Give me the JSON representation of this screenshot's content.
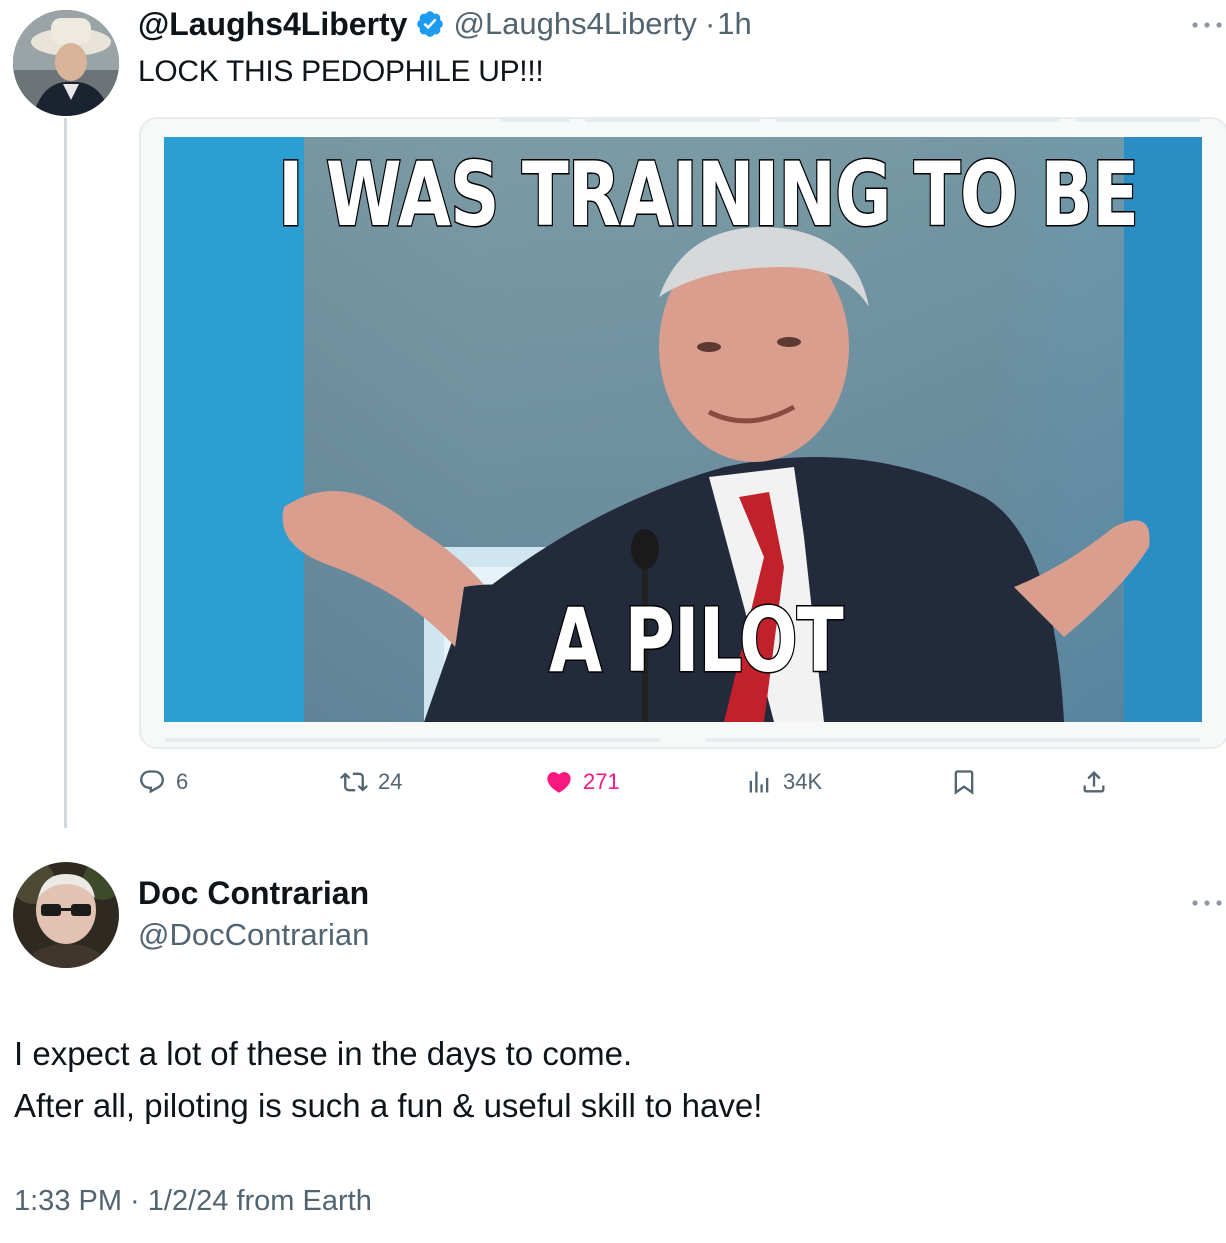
{
  "original_post": {
    "display_name": "@Laughs4Liberty",
    "verified": true,
    "handle": "@Laughs4Liberty",
    "separator": "·",
    "time_ago": "1h",
    "text": "LOCK THIS PEDOPHILE UP!!!",
    "media": {
      "top_caption": "I WAS TRAINING TO BE",
      "bottom_caption": "A PILOT"
    },
    "stats": {
      "replies": "6",
      "reposts": "24",
      "likes": "271",
      "views": "34K"
    }
  },
  "reply": {
    "display_name": "Doc Contrarian",
    "handle": "@DocContrarian",
    "text_line_1": "I expect a lot of these in the days to come.",
    "text_line_2": "After all, piloting is such a fun & useful skill to have!",
    "timestamp": "1:33 PM · 1/2/24 from Earth"
  },
  "colors": {
    "text_primary": "#0f1419",
    "text_secondary": "#536471",
    "verified_blue": "#1d9bf0",
    "like_pink": "#f91880"
  },
  "icons": [
    "more-icon",
    "verified-badge-icon",
    "reply-icon",
    "repost-icon",
    "like-icon",
    "views-icon",
    "bookmark-icon",
    "share-icon"
  ]
}
